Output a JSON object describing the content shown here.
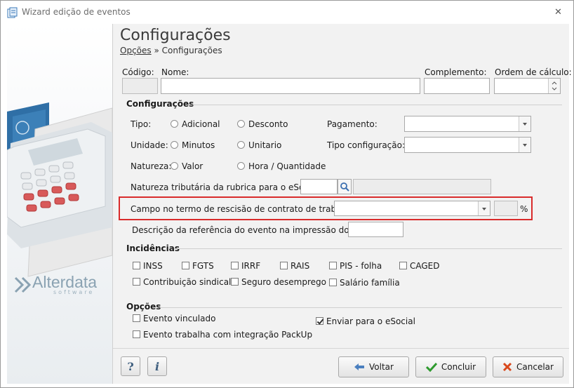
{
  "window": {
    "title": "Wizard edição de eventos",
    "close_glyph": "✕"
  },
  "header": {
    "title": "Configurações",
    "breadcrumb_link": "Opções",
    "breadcrumb_sep": " » ",
    "breadcrumb_current": "Configurações"
  },
  "fields": {
    "codigo_label": "Código:",
    "nome_label": "Nome:",
    "complemento_label": "Complemento:",
    "ordem_label": "Ordem de cálculo:"
  },
  "config": {
    "section": "Configurações",
    "tipo_label": "Tipo:",
    "tipo_options": [
      "Adicional",
      "Desconto"
    ],
    "unidade_label": "Unidade:",
    "unidade_options": [
      "Minutos",
      "Unitario"
    ],
    "natureza_label": "Natureza:",
    "natureza_options": [
      "Valor",
      "Hora / Quantidade"
    ],
    "pagamento_label": "Pagamento:",
    "tipo_config_label": "Tipo configuração:",
    "natureza_trib_label": "Natureza tributária da rubrica para o eSocial:",
    "campo_rescisao_label": "Campo no termo de rescisão de contrato de trabalho:",
    "percent": "%",
    "trct_label": "Descrição da referência do evento na impressão do TRCT:"
  },
  "incidencias": {
    "section": "Incidências",
    "row1": [
      "INSS",
      "FGTS",
      "IRRF",
      "RAIS",
      "PIS - folha",
      "CAGED"
    ],
    "row2": [
      "Contribuição sindical",
      "Seguro desemprego",
      "Salário família"
    ]
  },
  "opcoes": {
    "section": "Opções",
    "evento_vinculado": "Evento vinculado",
    "packup": "Evento trabalha com integração PackUp",
    "enviar_esocial": "Enviar para o eSocial",
    "enviar_esocial_checked": true
  },
  "buttons": {
    "help": "?",
    "info": "i",
    "voltar": "Voltar",
    "concluir": "Concluir",
    "cancelar": "Cancelar"
  },
  "brand": {
    "name": "Alterdata",
    "tagline": "software"
  },
  "colors": {
    "highlight": "#d92b2b",
    "brand": "#8aa2b2",
    "voltar_arrow": "#4a7fbf",
    "concluir_check": "#2e9a2e",
    "cancelar_x": "#d9481c"
  }
}
